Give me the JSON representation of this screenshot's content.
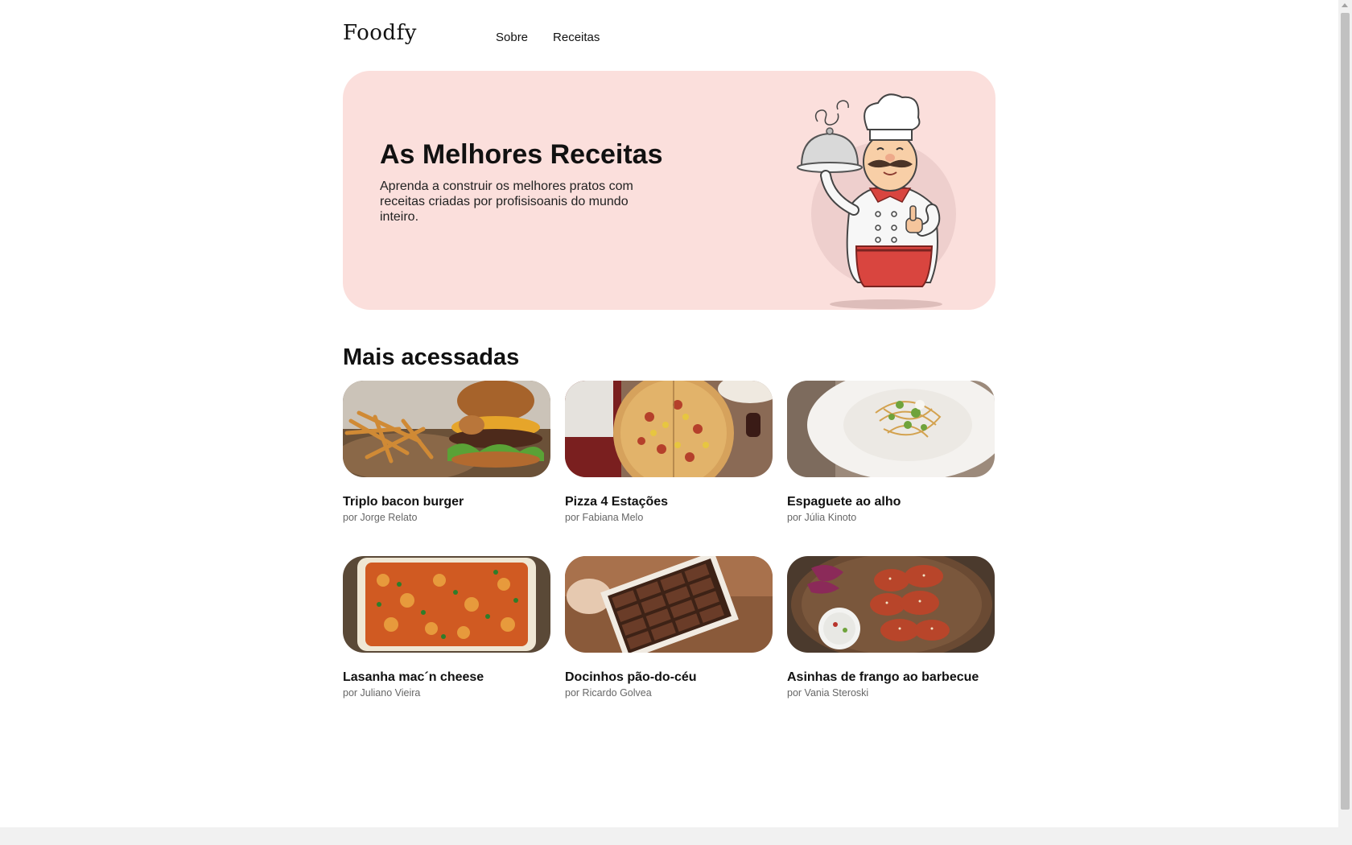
{
  "header": {
    "logo": "Foodfy",
    "nav": [
      {
        "label": "Sobre"
      },
      {
        "label": "Receitas"
      }
    ]
  },
  "hero": {
    "title": "As Melhores Receitas",
    "subtitle": "Aprenda a construir os melhores pratos com receitas criadas por profisisoanis do mundo inteiro.",
    "illustration": "chef-holding-cloche"
  },
  "section": {
    "title": "Mais acessadas"
  },
  "recipes": [
    {
      "title": "Triplo bacon burger",
      "author": "por Jorge Relato",
      "image": "burger-with-fries"
    },
    {
      "title": "Pizza 4 Estações",
      "author": "por Fabiana Melo",
      "image": "pizza"
    },
    {
      "title": "Espaguete ao alho",
      "author": "por Júlia Kinoto",
      "image": "spaghetti-plate"
    },
    {
      "title": "Lasanha mac´n cheese",
      "author": "por Juliano Vieira",
      "image": "mac-and-cheese-tray"
    },
    {
      "title": "Docinhos pão-do-céu",
      "author": "por Ricardo Golvea",
      "image": "chocolate-box"
    },
    {
      "title": "Asinhas de frango ao barbecue",
      "author": "por Vania Steroski",
      "image": "bbq-chicken-wings"
    }
  ],
  "colors": {
    "hero_bg": "#fbdfdc",
    "text": "#111111",
    "muted": "#666666"
  }
}
